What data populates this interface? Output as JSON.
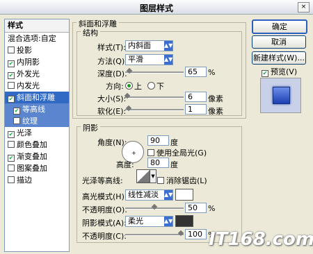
{
  "window": {
    "title": "图层样式",
    "close_label": "×"
  },
  "sidebar": {
    "header": "样式",
    "items": [
      {
        "label": "混合选项:自定",
        "checkbox": false,
        "checked": false
      },
      {
        "label": "投影",
        "checkbox": true,
        "checked": false
      },
      {
        "label": "内阴影",
        "checkbox": true,
        "checked": true
      },
      {
        "label": "外发光",
        "checkbox": true,
        "checked": true
      },
      {
        "label": "内发光",
        "checkbox": true,
        "checked": false
      },
      {
        "label": "斜面和浮雕",
        "checkbox": true,
        "checked": true
      },
      {
        "label": "等高线",
        "checkbox": true,
        "checked": true
      },
      {
        "label": "纹理",
        "checkbox": true,
        "checked": false
      },
      {
        "label": "光泽",
        "checkbox": true,
        "checked": true
      },
      {
        "label": "颜色叠加",
        "checkbox": true,
        "checked": false
      },
      {
        "label": "渐变叠加",
        "checkbox": true,
        "checked": true
      },
      {
        "label": "图案叠加",
        "checkbox": true,
        "checked": false
      },
      {
        "label": "描边",
        "checkbox": true,
        "checked": false
      }
    ]
  },
  "bevel": {
    "title": "斜面和浮雕",
    "structure_title": "结构",
    "style_label": "样式(T):",
    "style_value": "内斜面",
    "method_label": "方法(Q):",
    "method_value": "平滑",
    "depth_label": "深度(D):",
    "depth_value": "65",
    "depth_unit": "%",
    "depth_fraction": 0.065,
    "direction_label": "方向:",
    "dir_up": "上",
    "dir_down": "下",
    "size_label": "大小(S):",
    "size_value": "6",
    "size_unit": "像素",
    "size_fraction": 0.025,
    "soften_label": "软化(E):",
    "soften_value": "1",
    "soften_unit": "像素",
    "soften_fraction": 0.06
  },
  "shading": {
    "title": "阴影",
    "angle_label": "角度(N):",
    "angle_value": "90",
    "angle_unit": "度",
    "global_light": "使用全局光(G)",
    "altitude_label": "高度:",
    "altitude_value": "80",
    "altitude_unit": "度",
    "gloss_label": "光泽等高线:",
    "antialias": "消除锯齿(L)",
    "highlight_label": "高光模式(H):",
    "highlight_value": "线性减淡",
    "highlight_color": "#ffffff",
    "opacity1_label": "不透明度(O):",
    "opacity1_value": "50",
    "opacity1_unit": "%",
    "opacity1_fraction": 0.5,
    "shadow_label": "阴影模式(A):",
    "shadow_value": "柔光",
    "shadow_color": "#333333",
    "opacity2_label": "不透明度(C):",
    "opacity2_value": "100",
    "opacity2_unit": "%",
    "opacity2_fraction": 1.0
  },
  "buttons": {
    "ok": "确定",
    "cancel": "取消",
    "new_style": "新建样式(W)...",
    "preview": "预览(V)"
  },
  "watermark": "IT168.com"
}
